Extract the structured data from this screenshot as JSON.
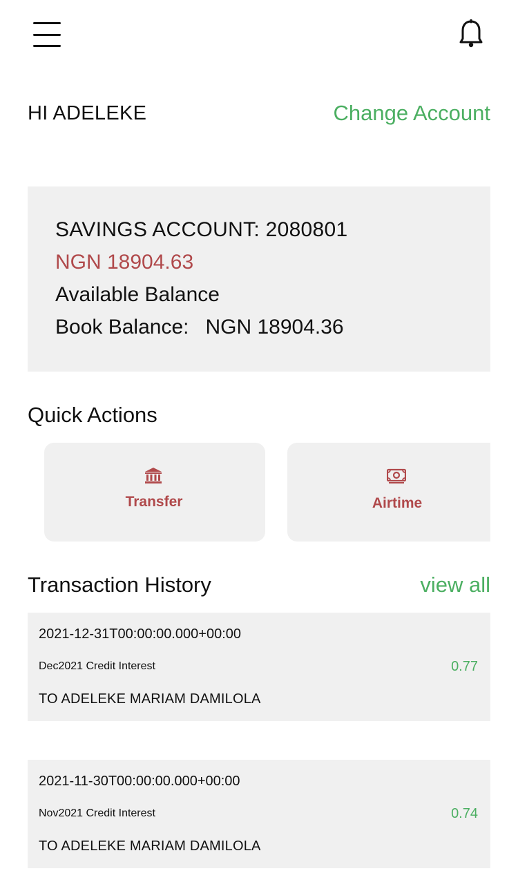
{
  "header": {
    "menu_icon": "hamburger-menu-icon",
    "notification_icon": "bell-icon"
  },
  "greeting": "HI ADELEKE",
  "change_account_label": "Change Account",
  "account": {
    "title": "SAVINGS ACCOUNT: 2080801",
    "balance": "NGN 18904.63",
    "available_label": "Available Balance",
    "book_label": "Book Balance:",
    "book_value": "NGN 18904.36"
  },
  "quick_actions": {
    "title": "Quick Actions",
    "items": [
      {
        "label": "Transfer",
        "icon": "bank-icon"
      },
      {
        "label": "Airtime",
        "icon": "money-icon"
      }
    ]
  },
  "transactions": {
    "title": "Transaction History",
    "view_all_label": "view all",
    "items": [
      {
        "date": "2021-12-31T00:00:00.000+00:00",
        "description": "Dec2021 Credit Interest",
        "amount": "0.77",
        "to": "TO ADELEKE MARIAM DAMILOLA"
      },
      {
        "date": "2021-11-30T00:00:00.000+00:00",
        "description": "Nov2021 Credit Interest",
        "amount": "0.74",
        "to": "TO ADELEKE MARIAM DAMILOLA"
      }
    ]
  },
  "colors": {
    "accent_green": "#4caf62",
    "accent_red": "#b0494b",
    "card_bg": "#f0f0f0"
  }
}
